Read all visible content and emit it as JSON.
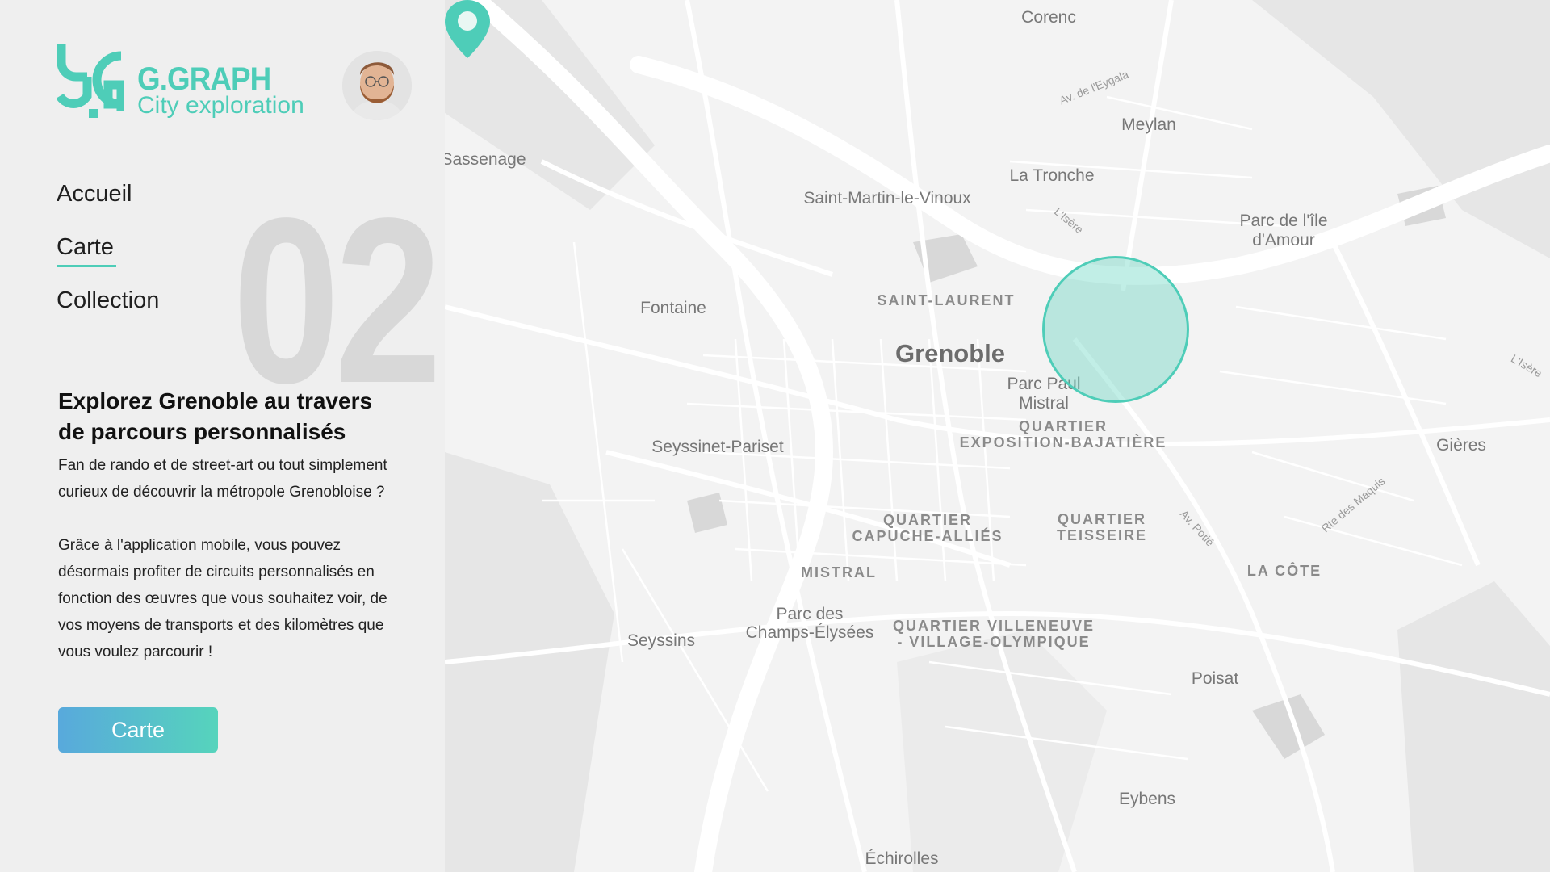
{
  "brand": {
    "name": "G.GRAPH",
    "tagline": "City exploration"
  },
  "nav": {
    "items": [
      "Accueil",
      "Carte",
      "Collection"
    ],
    "active": "Carte"
  },
  "section_number": "02",
  "intro": {
    "headline_line1": "Explorez Grenoble au travers",
    "headline_line2": "de parcours personnalisés",
    "paragraph1": "Fan de rando et de street-art ou tout simplement curieux de découvrir la métropole Grenobloise ?",
    "paragraph2": "Grâce à l'application mobile, vous pouvez désormais profiter de circuits personnalisés en fonction des œuvres que vous souhaitez voir, de vos moyens de transports et des kilomètres que vous voulez parcourir !"
  },
  "cta": {
    "label": "Carte"
  },
  "map": {
    "labels": {
      "corenc": "Corenc",
      "av_eygala": "Av. de l'Eygala",
      "meylan": "Meylan",
      "sassenage": "Sassenage",
      "la_tronche": "La Tronche",
      "saint_martin": "Saint-Martin-le-Vinoux",
      "isere1": "L'Isère",
      "parc_ile_line1": "Parc de l'île",
      "parc_ile_line2": "d'Amour",
      "fontaine": "Fontaine",
      "saint_laurent": "SAINT-LAURENT",
      "grenoble": "Grenoble",
      "isere2": "L'Isère",
      "parc_paul_line1": "Parc Paul",
      "parc_paul_line2": "Mistral",
      "expo_line1": "QUARTIER",
      "expo_line2": "EXPOSITION-BAJATIÈRE",
      "seyssinet": "Seyssinet-Pariset",
      "gieres": "Gières",
      "rte_maquis": "Rte des Maquis",
      "capuche_line1": "QUARTIER",
      "capuche_line2": "CAPUCHE-ALLIÉS",
      "teisseire_line1": "QUARTIER",
      "teisseire_line2": "TEISSEIRE",
      "av_potie": "Av. Potié",
      "mistral": "MISTRAL",
      "la_cote": "LA CÔTE",
      "champs_line1": "Parc des",
      "champs_line2": "Champs-Élysées",
      "villeneuve_line1": "QUARTIER VILLENEUVE",
      "villeneuve_line2": "- VILLAGE-OLYMPIQUE",
      "seyssins": "Seyssins",
      "poisat": "Poisat",
      "eybens": "Eybens",
      "echirolles": "Échirolles"
    },
    "accent": "#4ecdb8"
  },
  "colors": {
    "accent": "#4ecdb8",
    "button_start": "#58a9dc",
    "button_end": "#56d4bc"
  },
  "icons": {
    "logo": "gg-logo",
    "marker": "location-pin-icon",
    "avatar": "user-avatar"
  }
}
